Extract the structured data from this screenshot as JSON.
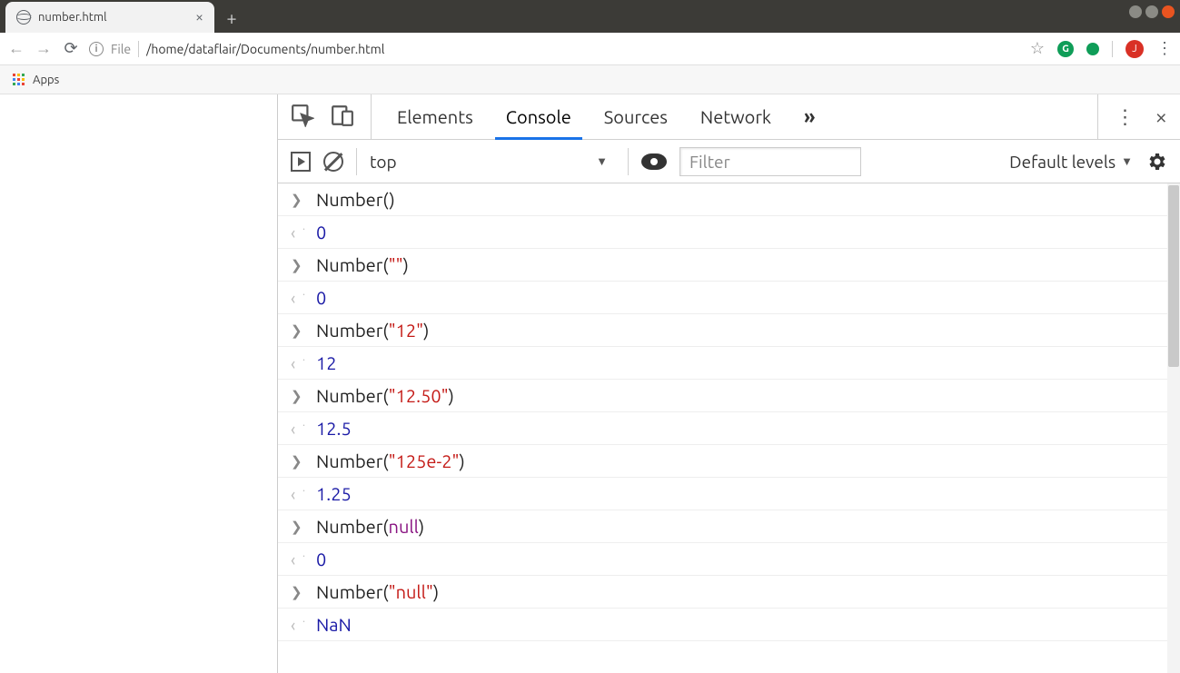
{
  "window": {
    "tab_title": "number.html"
  },
  "url": {
    "scheme": "File",
    "path": "/home/dataflair/Documents/number.html"
  },
  "bookmarks": {
    "apps": "Apps"
  },
  "avatar_letter": "J",
  "ext1_letter": "G",
  "devtools": {
    "tabs": {
      "elements": "Elements",
      "console": "Console",
      "sources": "Sources",
      "network": "Network"
    },
    "console_bar": {
      "context": "top",
      "filter_placeholder": "Filter",
      "levels": "Default levels"
    }
  },
  "console": [
    {
      "type": "in",
      "parts": [
        {
          "t": "fn",
          "v": "Number()"
        }
      ]
    },
    {
      "type": "out",
      "parts": [
        {
          "t": "num",
          "v": "0"
        }
      ]
    },
    {
      "type": "in",
      "parts": [
        {
          "t": "fn",
          "v": "Number("
        },
        {
          "t": "str",
          "v": "\"\""
        },
        {
          "t": "fn",
          "v": ")"
        }
      ]
    },
    {
      "type": "out",
      "parts": [
        {
          "t": "num",
          "v": "0"
        }
      ]
    },
    {
      "type": "in",
      "parts": [
        {
          "t": "fn",
          "v": "Number("
        },
        {
          "t": "str",
          "v": "\"12\""
        },
        {
          "t": "fn",
          "v": ")"
        }
      ]
    },
    {
      "type": "out",
      "parts": [
        {
          "t": "num",
          "v": "12"
        }
      ]
    },
    {
      "type": "in",
      "parts": [
        {
          "t": "fn",
          "v": "Number("
        },
        {
          "t": "str",
          "v": "\"12.50\""
        },
        {
          "t": "fn",
          "v": ")"
        }
      ]
    },
    {
      "type": "out",
      "parts": [
        {
          "t": "num",
          "v": "12.5"
        }
      ]
    },
    {
      "type": "in",
      "parts": [
        {
          "t": "fn",
          "v": "Number("
        },
        {
          "t": "str",
          "v": "\"125e-2\""
        },
        {
          "t": "fn",
          "v": ")"
        }
      ]
    },
    {
      "type": "out",
      "parts": [
        {
          "t": "num",
          "v": "1.25"
        }
      ]
    },
    {
      "type": "in",
      "parts": [
        {
          "t": "fn",
          "v": "Number("
        },
        {
          "t": "kw",
          "v": "null"
        },
        {
          "t": "fn",
          "v": ")"
        }
      ]
    },
    {
      "type": "out",
      "parts": [
        {
          "t": "num",
          "v": "0"
        }
      ]
    },
    {
      "type": "in",
      "parts": [
        {
          "t": "fn",
          "v": "Number("
        },
        {
          "t": "str",
          "v": "\"null\""
        },
        {
          "t": "fn",
          "v": ")"
        }
      ]
    },
    {
      "type": "out",
      "parts": [
        {
          "t": "num",
          "v": "NaN"
        }
      ]
    }
  ]
}
